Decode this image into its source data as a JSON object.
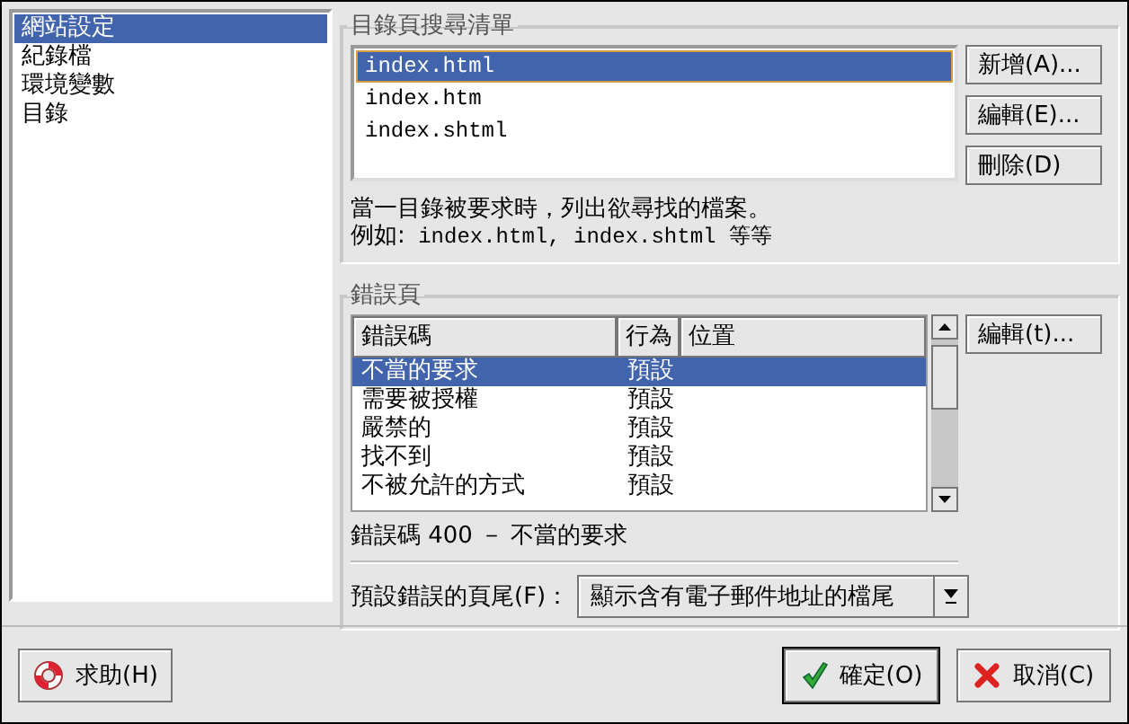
{
  "sidebar": {
    "items": [
      {
        "label": "網站設定",
        "selected": true
      },
      {
        "label": "紀錄檔",
        "selected": false
      },
      {
        "label": "環境變數",
        "selected": false
      },
      {
        "label": "目錄",
        "selected": false
      }
    ]
  },
  "directory_group": {
    "title": "目錄頁搜尋清單",
    "files": [
      {
        "label": "index.html",
        "selected": true
      },
      {
        "label": "index.htm",
        "selected": false
      },
      {
        "label": "index.shtml",
        "selected": false
      }
    ],
    "buttons": [
      "新增(A)...",
      "編輯(E)...",
      "刪除(D)"
    ],
    "description": "當一目錄被要求時，列出欲尋找的檔案。",
    "example_label": "例如:",
    "example": "index.html, index.shtml 等等"
  },
  "error_group": {
    "title": "錯誤頁",
    "columns": [
      "錯誤碼",
      "行為",
      "位置"
    ],
    "rows": [
      {
        "code": "不當的要求",
        "behavior": "預設",
        "selected": true
      },
      {
        "code": "需要被授權",
        "behavior": "預設",
        "selected": false
      },
      {
        "code": "嚴禁的",
        "behavior": "預設",
        "selected": false
      },
      {
        "code": "找不到",
        "behavior": "預設",
        "selected": false
      },
      {
        "code": "不被允許的方式",
        "behavior": "預設",
        "selected": false
      }
    ],
    "edit_button": "編輯(t)...",
    "status": "錯誤碼 400 － 不當的要求",
    "footer_label": "預設錯誤的頁尾(F)：",
    "footer_value": "顯示含有電子郵件地址的檔尾"
  },
  "buttons": [
    {
      "kind": "help",
      "label": "求助(H)"
    },
    {
      "kind": "ok",
      "label": "確定(O)"
    },
    {
      "kind": "cancel",
      "label": "取消(C)"
    }
  ]
}
